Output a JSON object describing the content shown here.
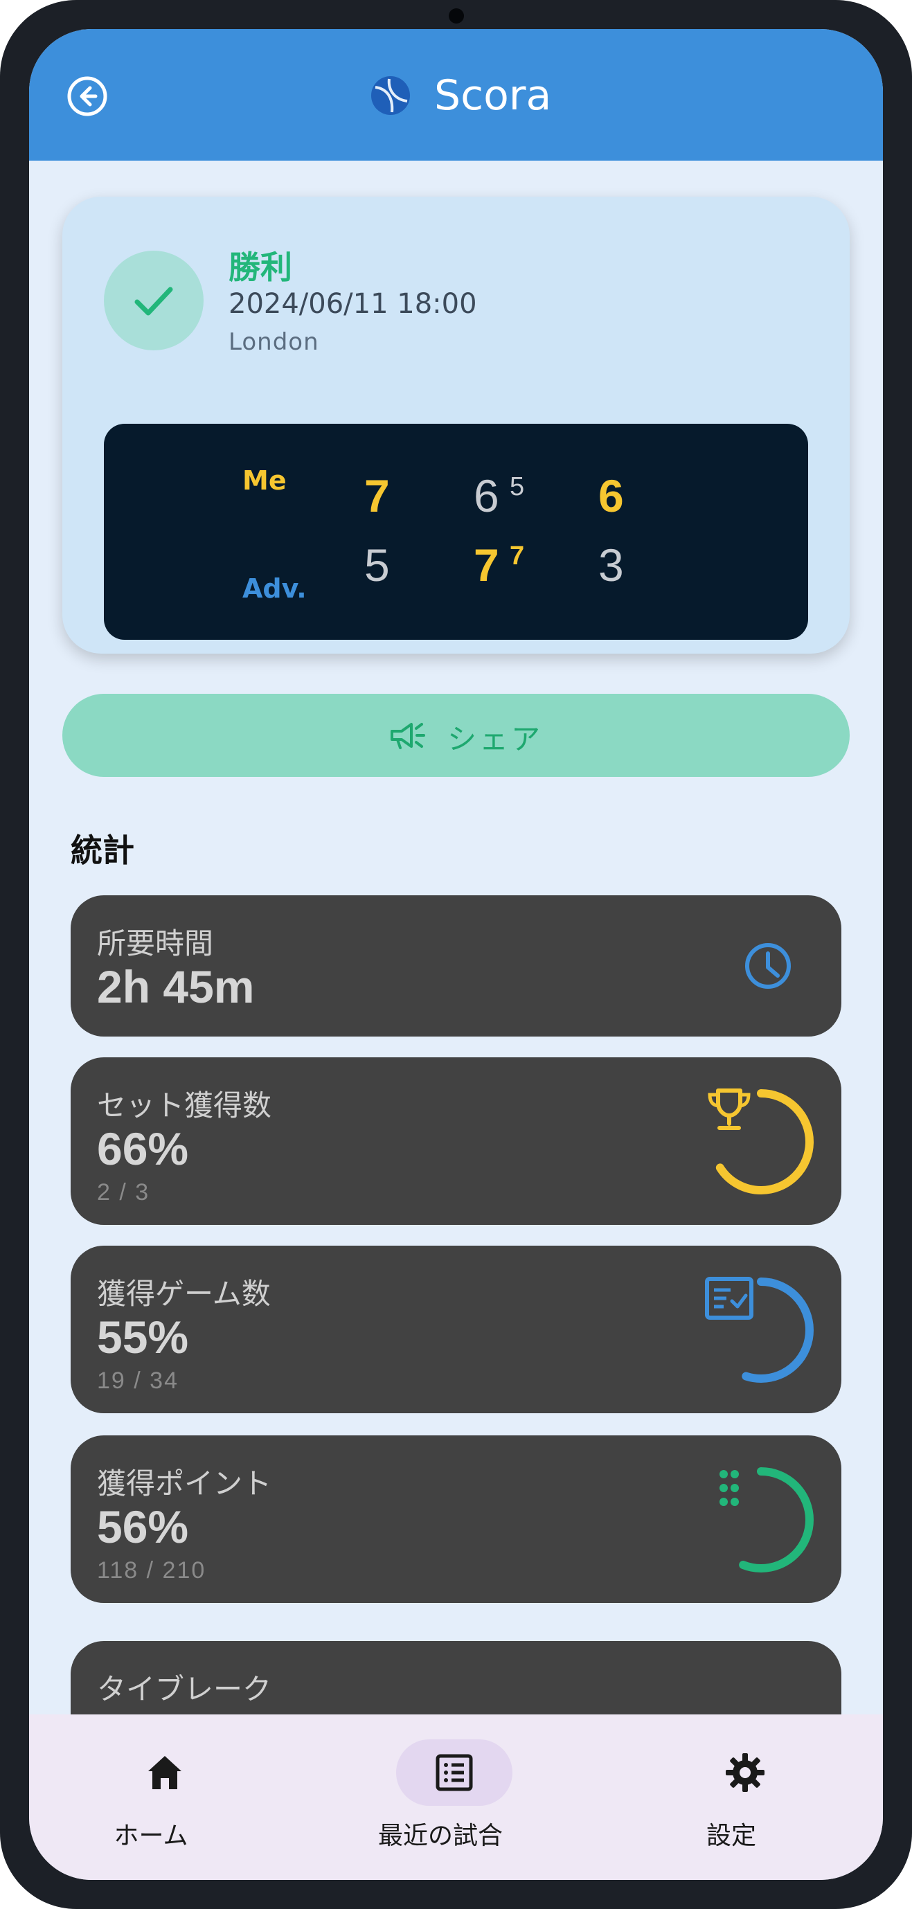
{
  "app": {
    "title": "Scora"
  },
  "match": {
    "result": "勝利",
    "datetime": "2024/06/11 18:00",
    "location": "London",
    "me_label": "Me",
    "adv_label": "Adv.",
    "sets": [
      {
        "me": "7",
        "adv": "5",
        "winner": "me"
      },
      {
        "me": "6",
        "me_tb": "5",
        "adv": "7",
        "adv_tb": "7",
        "winner": "adv"
      },
      {
        "me": "6",
        "adv": "3",
        "winner": "me"
      }
    ]
  },
  "share": {
    "label": "シェア"
  },
  "stats": {
    "heading": "統計",
    "duration": {
      "label": "所要時間",
      "value": "2h 45m"
    },
    "sets_won": {
      "label": "セット獲得数",
      "value": "66%",
      "detail": "2 / 3",
      "fraction": 0.66
    },
    "games_won": {
      "label": "獲得ゲーム数",
      "value": "55%",
      "detail": "19 / 34",
      "fraction": 0.55
    },
    "points_won": {
      "label": "獲得ポイント",
      "value": "56%",
      "detail": "118 / 210",
      "fraction": 0.56
    },
    "tiebreak": {
      "label": "タイブレーク"
    }
  },
  "nav": {
    "home": "ホーム",
    "recent": "最近の試合",
    "settings": "設定"
  },
  "colors": {
    "primary": "#3d8fdb",
    "win_green": "#22b67a",
    "gold": "#f6c630",
    "card_dark": "#424242",
    "scoreboard": "#061a2c"
  }
}
